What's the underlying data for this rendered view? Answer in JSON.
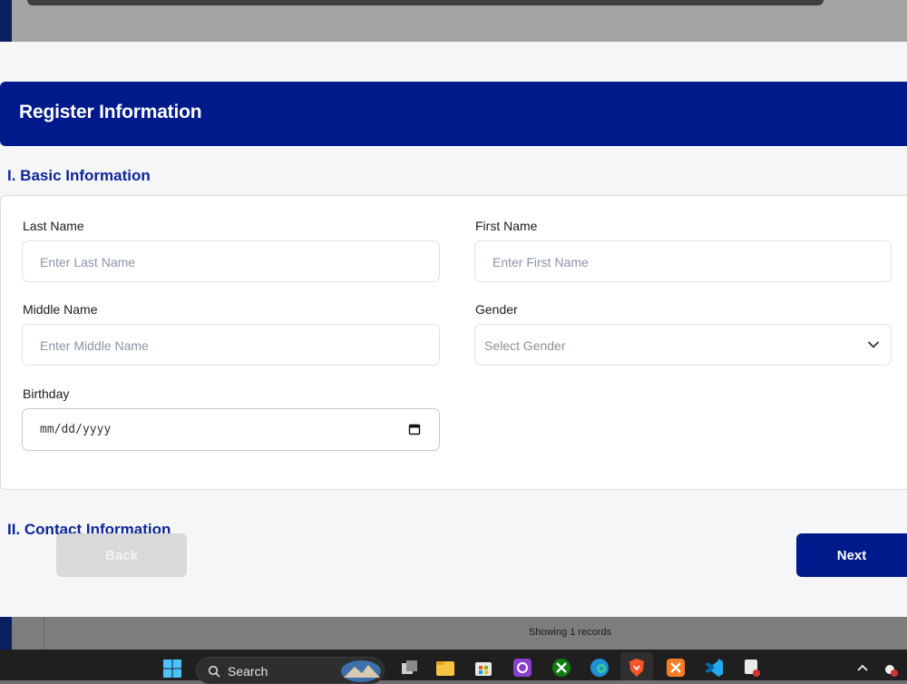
{
  "header": {
    "title": "Register Information"
  },
  "sections": {
    "basic": "I. Basic Information",
    "contact": "II. Contact Information"
  },
  "form": {
    "last_name": {
      "label": "Last Name",
      "placeholder": "Enter Last Name"
    },
    "first_name": {
      "label": "First Name",
      "placeholder": "Enter First Name"
    },
    "middle_name": {
      "label": "Middle Name",
      "placeholder": "Enter Middle Name"
    },
    "gender": {
      "label": "Gender",
      "placeholder": "Select Gender"
    },
    "birthday": {
      "label": "Birthday",
      "placeholder": "mm/dd/yyyy"
    }
  },
  "buttons": {
    "back": "Back",
    "next": "Next"
  },
  "status": {
    "text": "Showing 1 records"
  },
  "taskbar": {
    "search_label": "Search",
    "icons": [
      "windows-start-icon",
      "search-icon",
      "landscape-widget-icon",
      "task-view-icon",
      "file-explorer-icon",
      "store-icon",
      "photo-app-icon",
      "xbox-icon",
      "edge-icon",
      "brave-icon",
      "xampp-icon",
      "vscode-icon",
      "snipping-tool-icon",
      "chevron-up-icon",
      "network-icon"
    ]
  },
  "colors": {
    "primary": "#001a8c",
    "section": "#0f2599",
    "back_button": "#d9d9d9"
  }
}
